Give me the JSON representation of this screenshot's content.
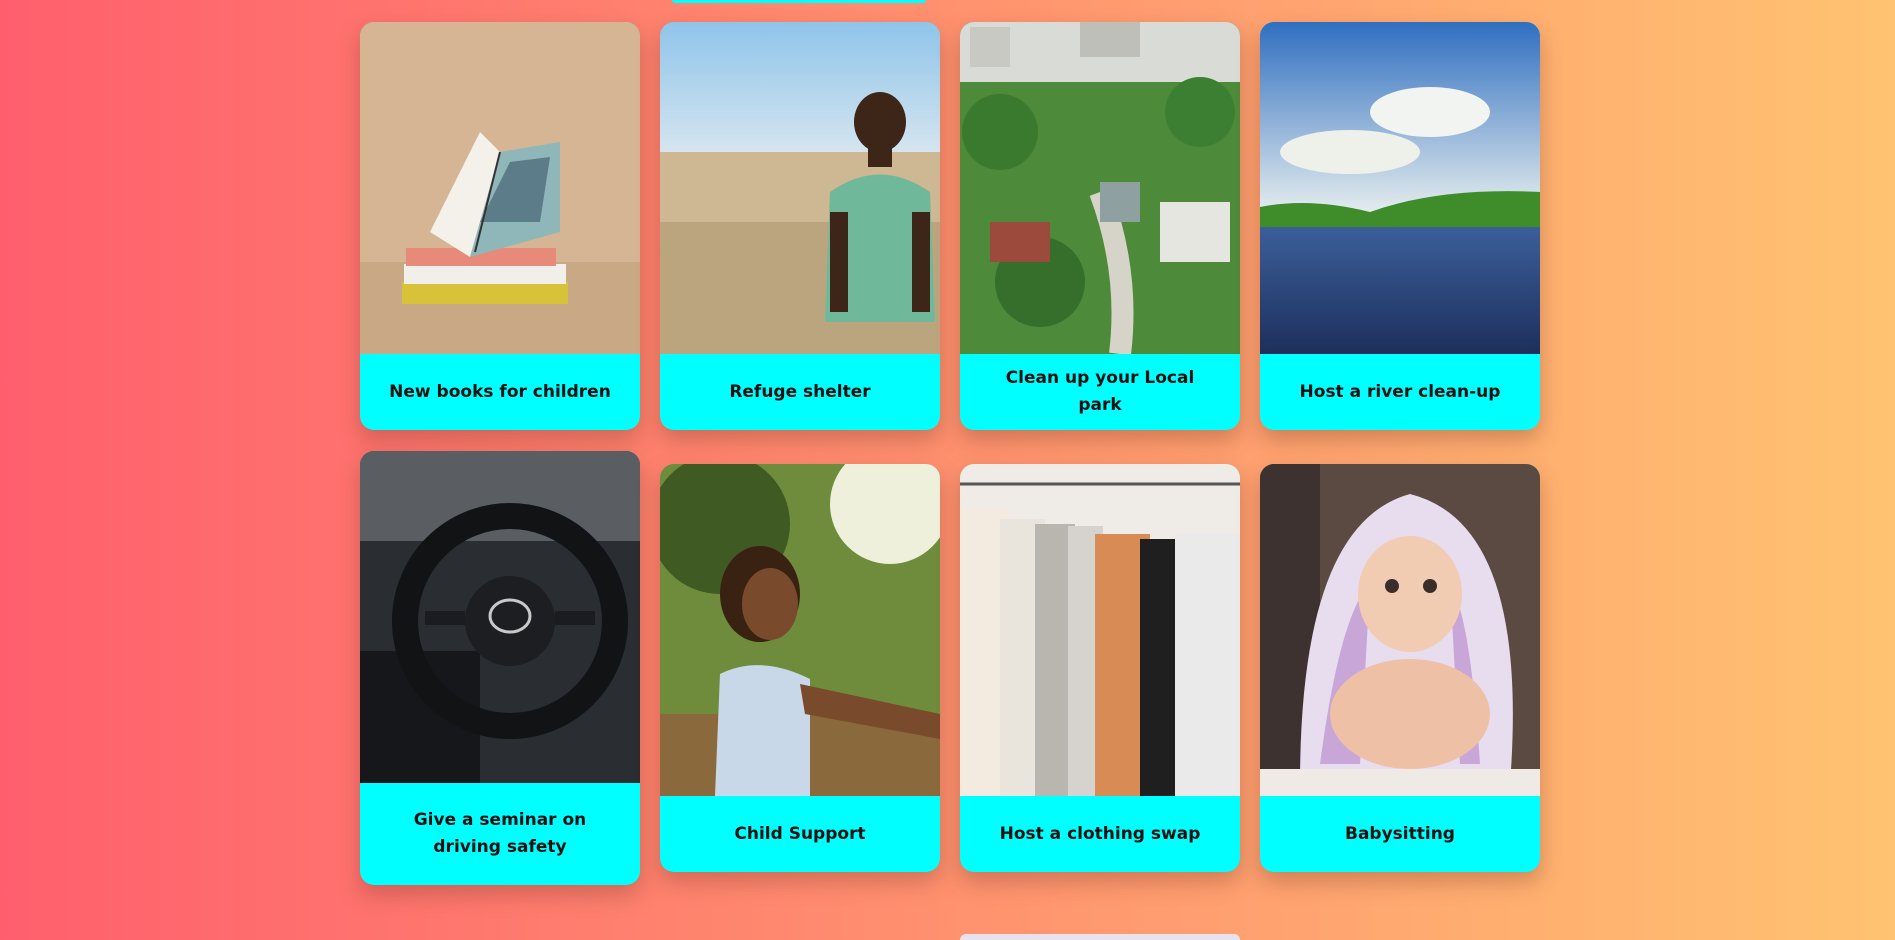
{
  "cards": [
    {
      "title": "New books for children",
      "image": "books-photo"
    },
    {
      "title": "Refuge shelter",
      "image": "boy-in-field-photo"
    },
    {
      "title": "Clean up your Local park",
      "image": "park-aerial-photo"
    },
    {
      "title": "Host a river clean-up",
      "image": "river-photo"
    },
    {
      "title": "Give a seminar on driving safety",
      "image": "steering-wheel-photo"
    },
    {
      "title": "Child Support",
      "image": "girl-smiling-photo"
    },
    {
      "title": "Host a clothing swap",
      "image": "clothing-rack-photo"
    },
    {
      "title": "Babysitting",
      "image": "baby-blanket-photo"
    }
  ]
}
